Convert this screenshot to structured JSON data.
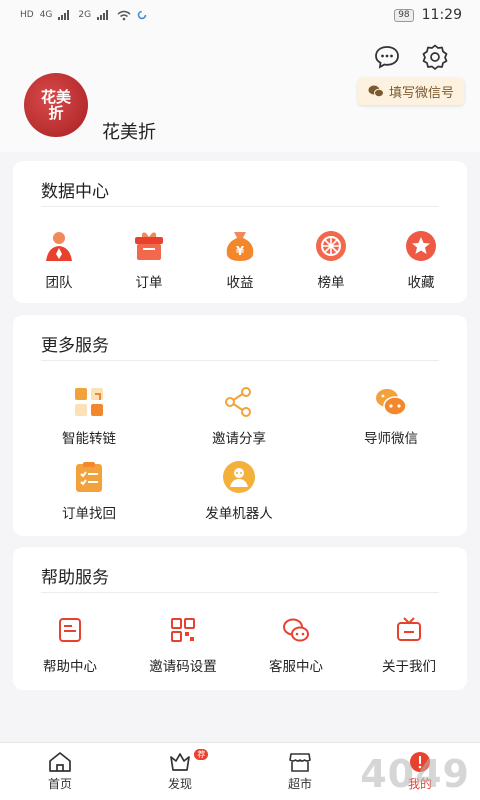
{
  "status_bar": {
    "network": "4G",
    "network2": "2G",
    "battery": "98",
    "time": "11:29"
  },
  "header": {
    "username": "花美折",
    "wechat_button": "填写微信号",
    "avatar_text": "花美折"
  },
  "data_center": {
    "title": "数据中心",
    "items": [
      {
        "label": "团队",
        "icon": "team-icon"
      },
      {
        "label": "订单",
        "icon": "gift-icon"
      },
      {
        "label": "收益",
        "icon": "money-bag-icon"
      },
      {
        "label": "榜单",
        "icon": "ranking-icon"
      },
      {
        "label": "收藏",
        "icon": "star-icon"
      }
    ]
  },
  "more_services": {
    "title": "更多服务",
    "items": [
      {
        "label": "智能转链",
        "icon": "convert-link-icon"
      },
      {
        "label": "邀请分享",
        "icon": "share-icon"
      },
      {
        "label": "导师微信",
        "icon": "mentor-chat-icon"
      },
      {
        "label": "订单找回",
        "icon": "clipboard-icon"
      },
      {
        "label": "发单机器人",
        "icon": "robot-icon"
      }
    ]
  },
  "help_services": {
    "title": "帮助服务",
    "items": [
      {
        "label": "帮助中心",
        "icon": "help-doc-icon"
      },
      {
        "label": "邀请码设置",
        "icon": "qr-code-icon"
      },
      {
        "label": "客服中心",
        "icon": "customer-service-icon"
      },
      {
        "label": "关于我们",
        "icon": "tv-icon"
      }
    ]
  },
  "bottom_nav": {
    "items": [
      {
        "label": "首页",
        "icon": "home-icon"
      },
      {
        "label": "发现",
        "icon": "discover-icon",
        "badge": "荐"
      },
      {
        "label": "超市",
        "icon": "store-icon"
      },
      {
        "label": "我的",
        "icon": "profile-icon"
      }
    ]
  },
  "watermark": "4049",
  "colors": {
    "accent": "#e8422f",
    "orange": "#f3a23b",
    "background": "#f5f5f7"
  }
}
